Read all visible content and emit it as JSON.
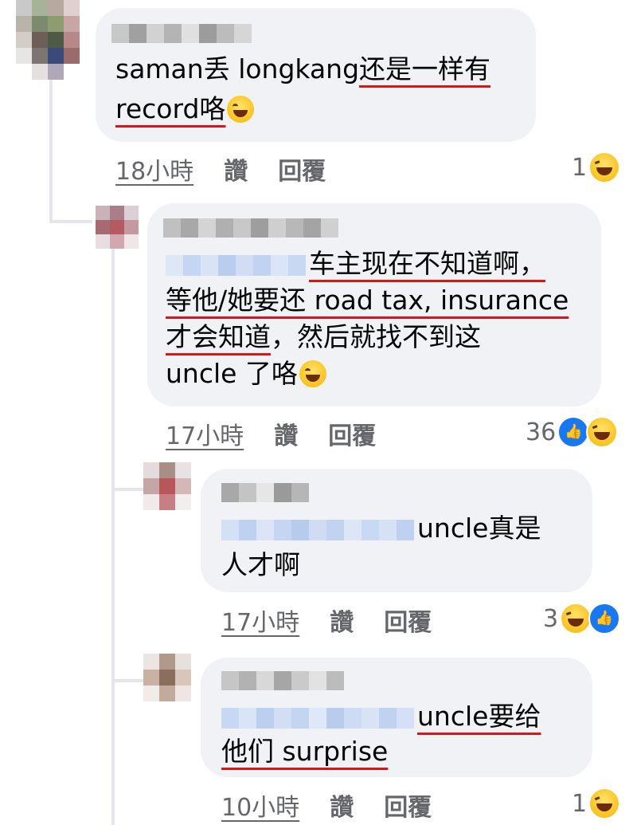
{
  "comments": [
    {
      "line1": "saman丢 longkang",
      "line1_ul": "还是一样有",
      "line2_ul": "record咯",
      "emoji": "grinning-sweat-emoji",
      "time": "18小時",
      "like": "讚",
      "reply": "回覆",
      "reaction_count": "1",
      "reactions": [
        "haha"
      ]
    },
    {
      "line1_ul": "车主现在不知道啊，",
      "line2_ul": "等他/她要还 road tax, insurance",
      "line3_ul": "才会知道",
      "line3_rest": "，然后就找不到这",
      "line4": "uncle 了咯",
      "emoji": "grinning-squinting-emoji",
      "time": "17小時",
      "like": "讚",
      "reply": "回覆",
      "reaction_count": "36",
      "reactions": [
        "like",
        "haha"
      ]
    },
    {
      "line1": "uncle真是",
      "line2": "人才啊",
      "time": "17小時",
      "like": "讚",
      "reply": "回覆",
      "reaction_count": "3",
      "reactions": [
        "haha",
        "like"
      ]
    },
    {
      "line1_ul": "uncle要给",
      "line2_ul": "他们 surprise",
      "time": "10小時",
      "like": "讚",
      "reply": "回覆",
      "reaction_count": "1",
      "reactions": [
        "haha"
      ]
    }
  ],
  "colors": {
    "bubble": "#f0f2f5",
    "underline": "#e0131a",
    "meta_text": "#65676b",
    "mention_blur": "#c5d6f2",
    "name_blur": "#9a9a9a"
  }
}
